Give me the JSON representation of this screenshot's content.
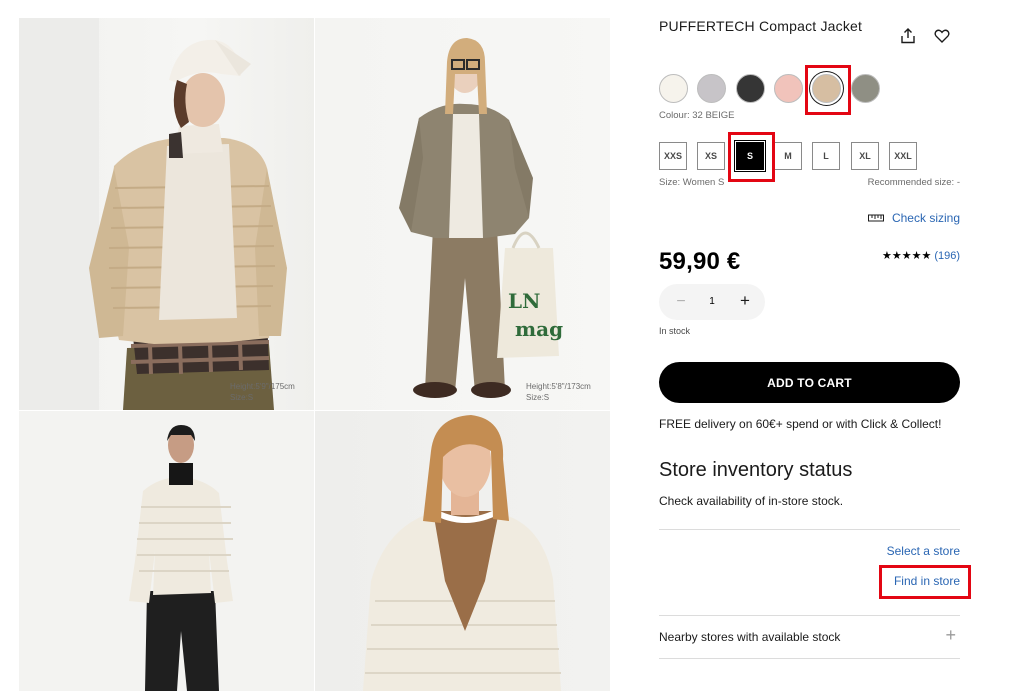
{
  "gallery": {
    "photo1_caption": "Height:5'9\"/175cm\nSize:S",
    "photo2_caption": "Height:5'8\"/173cm\nSize:S",
    "bag_text": "LN\nmag"
  },
  "product": {
    "title": "PUFFERTECH Compact Jacket",
    "colour_label": "Colour: 32 BEIGE",
    "colours": [
      "#f6f3ec",
      "#c7c4c8",
      "#353535",
      "#f1c3bb",
      "#d6bea2",
      "#8f8f84"
    ],
    "selected_colour_index": 4,
    "sizes": [
      "XXS",
      "XS",
      "S",
      "M",
      "L",
      "XL",
      "XXL"
    ],
    "selected_size_index": 2,
    "size_label": "Size: Women S",
    "recommended_size": "Recommended size: -",
    "check_sizing": "Check sizing",
    "price": "59,90 €",
    "stars": "★★★★★",
    "review_count": "(196)",
    "quantity": "1",
    "stock_status": "In stock",
    "add_to_cart": "ADD TO CART",
    "delivery": "FREE delivery on 60€+ spend or with Click & Collect!"
  },
  "store": {
    "heading": "Store inventory status",
    "subtext": "Check availability of in-store stock.",
    "select_store": "Select a store",
    "find_in_store": "Find in store",
    "nearby": "Nearby stores with available stock"
  },
  "colors": {
    "link": "#2a66b3",
    "highlight": "#e30613",
    "button": "#000000"
  }
}
